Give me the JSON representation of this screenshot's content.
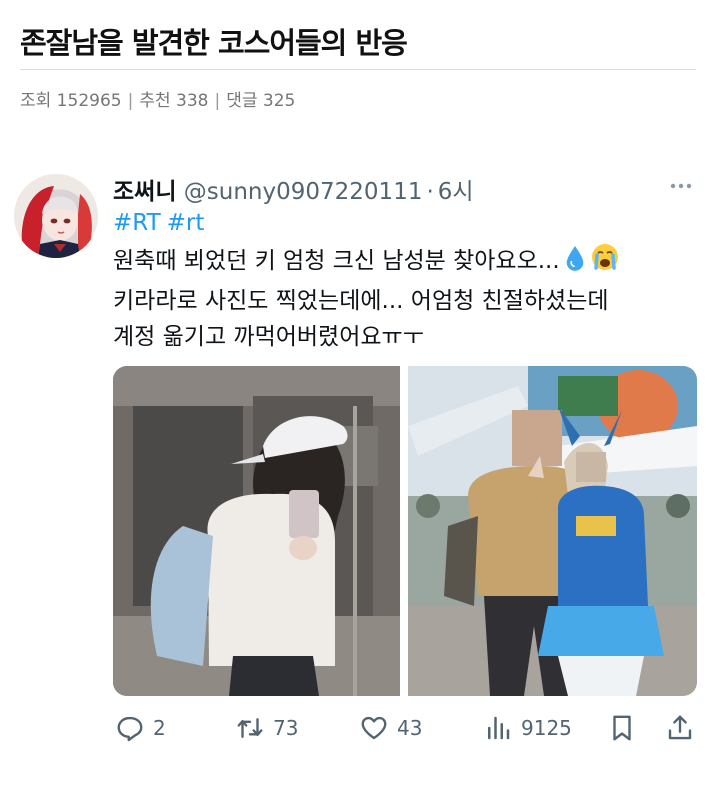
{
  "post": {
    "title": "존잘남을 발견한 코스어들의 반응",
    "meta": {
      "views": "조회 152965",
      "recommends": "추천 338",
      "comments": "댓글 325",
      "separator": "|"
    }
  },
  "tweet": {
    "display_name": "조써니",
    "handle": "@sunny0907220111",
    "dot": "·",
    "time": "6시",
    "hashtags": [
      "#RT",
      "#rt"
    ],
    "lines": [
      "원축때 뵈었던 키 엄청 크신 남성분 찾아요오...",
      "키라라로 사진도 찍었는데에... 어엄청 친절하셨는데",
      "계정 옮기고 까먹어버렸어요ㅠㅜ"
    ],
    "emojis": [
      "droplet-emoji",
      "crying-face-emoji"
    ],
    "actions": {
      "replies": "2",
      "retweets": "73",
      "likes": "43",
      "views": "9125"
    }
  },
  "icons": [
    "more-icon",
    "reply-icon",
    "retweet-icon",
    "like-icon",
    "views-icon",
    "bookmark-icon",
    "share-icon"
  ],
  "colors": {
    "hashtag": "#1d9bf0",
    "muted": "#536471",
    "meta": "#767676",
    "title": "#111111"
  }
}
